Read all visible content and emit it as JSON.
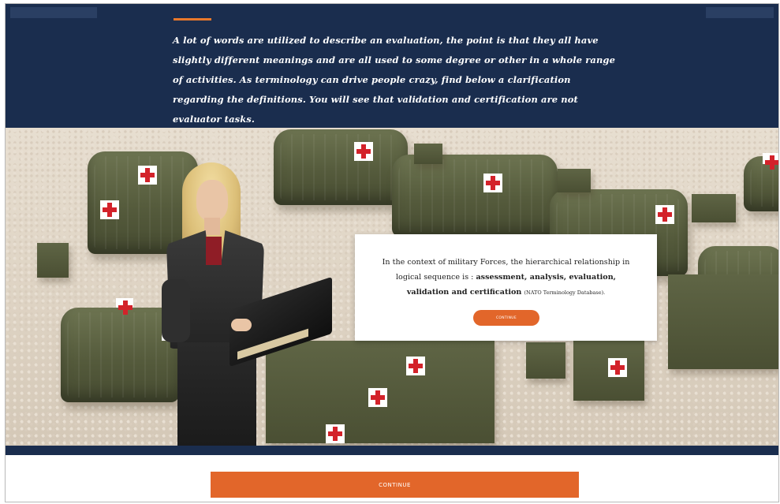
{
  "header": {
    "intro_text": "A lot of words are utilized to describe an evaluation, the point is that they all have slightly different meanings and are all used to some degree or other in a whole range of activities.  As terminology can drive people crazy, find below a clarification regarding the definitions. You will see that validation and certification are not evaluator tasks."
  },
  "dialog": {
    "text_lead": "In the context of military Forces, the hierarchical relationship in logical sequence is :",
    "text_terms": "assessment, analysis, evaluation, validation and certification",
    "text_source": "(NATO Terminology Database).",
    "button_label": "CONTINUE"
  },
  "footer": {
    "continue_label": "CONTINUE"
  },
  "colors": {
    "header_bg": "#1a2d4e",
    "accent": "#e2662a",
    "cross_red": "#d3222a"
  }
}
